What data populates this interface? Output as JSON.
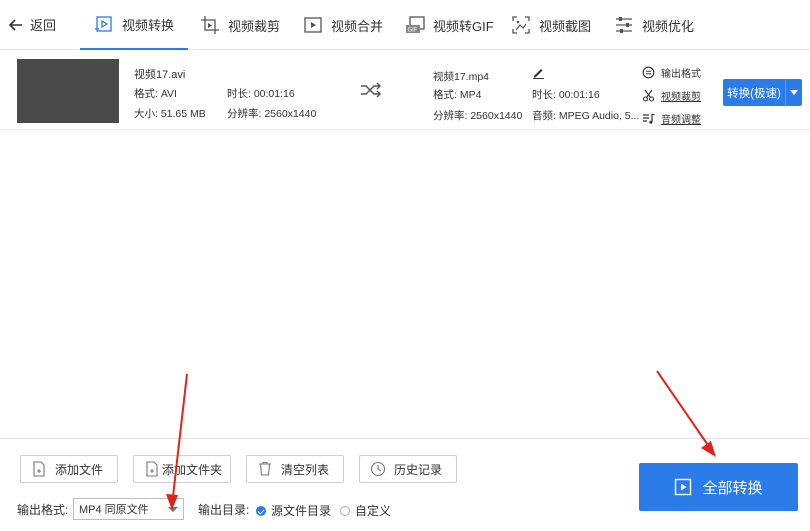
{
  "nav": {
    "back_label": "返回",
    "tabs": [
      {
        "label": "视频转换",
        "icon": "video-convert-icon"
      },
      {
        "label": "视频裁剪",
        "icon": "video-crop-icon"
      },
      {
        "label": "视频合并",
        "icon": "video-merge-icon"
      },
      {
        "label": "视频转GIF",
        "icon": "gif-icon"
      },
      {
        "label": "视频截图",
        "icon": "screenshot-icon"
      },
      {
        "label": "视频优化",
        "icon": "sliders-icon"
      }
    ],
    "active_tab": "视频转换"
  },
  "file": {
    "source": {
      "name": "视频17.avi",
      "format": "格式: AVI",
      "duration": "时长: 00:01:16",
      "size": "大小: 51.65 MB",
      "resolution": "分辨率: 2560x1440"
    },
    "output": {
      "name": "视频17.mp4",
      "format": "格式: MP4",
      "duration": "时长: 00:01:16",
      "resolution": "分辨率: 2560x1440",
      "audio": "音频: MPEG Audio, 5..."
    },
    "actions": {
      "output_format": "输出格式",
      "video_crop": "视频裁剪",
      "audio_adjust": "音频调整"
    },
    "convert_label": "转换(极速)"
  },
  "toolbar": {
    "add_file": "添加文件",
    "add_folder": "添加文件夹",
    "clear_list": "清空列表",
    "history": "历史记录"
  },
  "output_settings": {
    "format_label": "输出格式:",
    "format_value": "MP4 同原文件",
    "dir_label": "输出目录:",
    "dir_options": [
      "源文件目录",
      "自定义"
    ],
    "dir_selected": "源文件目录"
  },
  "convert_all_label": "全部转换",
  "colors": {
    "accent": "#2b7ce9",
    "annotation_arrow": "#e0231c"
  }
}
